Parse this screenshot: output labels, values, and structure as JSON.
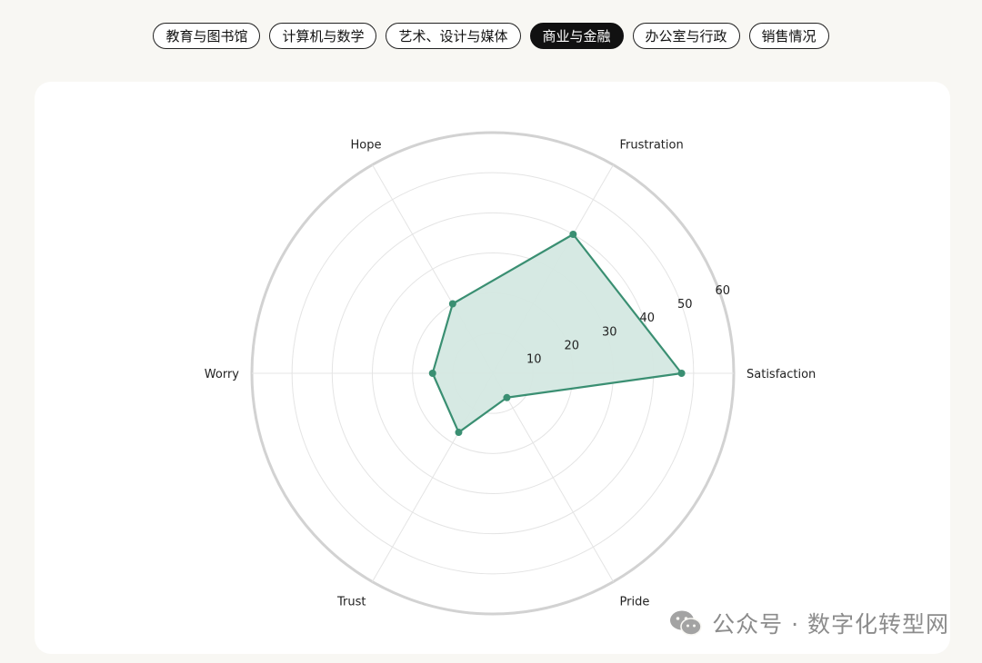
{
  "tabs": [
    {
      "label": "教育与图书馆",
      "active": false
    },
    {
      "label": "计算机与数学",
      "active": false
    },
    {
      "label": "艺术、设计与媒体",
      "active": false
    },
    {
      "label": "商业与金融",
      "active": true
    },
    {
      "label": "办公室与行政",
      "active": false
    },
    {
      "label": "销售情况",
      "active": false
    }
  ],
  "colors": {
    "series_stroke": "#3a8f72",
    "series_fill": "#d4e8e1",
    "grid": "#e4e4e4",
    "outer_ring": "#d2d2d2",
    "text": "#222222",
    "active_tab_bg": "#111111"
  },
  "chart_data": {
    "type": "radar",
    "axes": [
      "Satisfaction",
      "Frustration",
      "Hope",
      "Worry",
      "Trust",
      "Pride"
    ],
    "values": [
      47,
      40,
      20,
      15,
      17,
      7
    ],
    "rlim": [
      0,
      60
    ],
    "rticks": [
      10,
      20,
      30,
      40,
      50,
      60
    ],
    "grid": true
  },
  "watermark": {
    "text": "公众号 · 数字化转型网",
    "icon": "wechat-icon"
  }
}
